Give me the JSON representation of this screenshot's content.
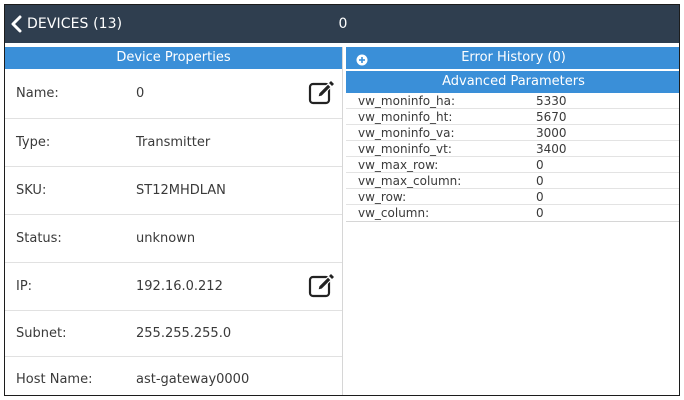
{
  "header": {
    "back_label": "DEVICES (13)",
    "title": "0"
  },
  "device_properties": {
    "title": "Device Properties",
    "rows": [
      {
        "label": "Name:",
        "value": "0",
        "editable": true
      },
      {
        "label": "Type:",
        "value": "Transmitter",
        "editable": false
      },
      {
        "label": "SKU:",
        "value": "ST12MHDLAN",
        "editable": false
      },
      {
        "label": "Status:",
        "value": "unknown",
        "editable": false
      },
      {
        "label": "IP:",
        "value": "192.16.0.212",
        "editable": true
      },
      {
        "label": "Subnet:",
        "value": "255.255.255.0",
        "editable": false
      },
      {
        "label": "Host Name:",
        "value": "ast-gateway0000",
        "editable": false
      }
    ]
  },
  "error_history": {
    "label": "Error History (0)"
  },
  "advanced_parameters": {
    "title": "Advanced Parameters",
    "params": [
      {
        "name": "vw_moninfo_ha:",
        "value": "5330"
      },
      {
        "name": "vw_moninfo_ht:",
        "value": "5670"
      },
      {
        "name": "vw_moninfo_va:",
        "value": "3000"
      },
      {
        "name": "vw_moninfo_vt:",
        "value": "3400"
      },
      {
        "name": "vw_max_row:",
        "value": "0"
      },
      {
        "name": "vw_max_column:",
        "value": "0"
      },
      {
        "name": "vw_row:",
        "value": "0"
      },
      {
        "name": "vw_column:",
        "value": "0"
      }
    ]
  },
  "colors": {
    "topbar": "#2f3e4f",
    "accent": "#3a8fd8"
  },
  "icons": {
    "back": "chevron-left-icon",
    "edit": "edit-icon",
    "expand": "plus-circle-icon"
  }
}
